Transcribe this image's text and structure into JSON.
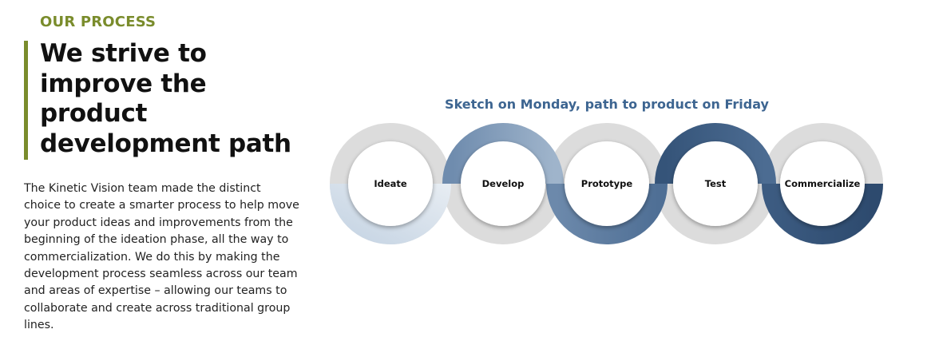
{
  "section": {
    "eyebrow": "OUR PROCESS",
    "headline": "We strive to improve the product development path",
    "body": "The Kinetic Vision team made the distinct choice to create a smarter process to help move your product ideas and improvements from the beginning of the ideation phase, all the way to commercialization. We do this by making the development process seamless across our team and areas of expertise – allowing our teams to collaborate and create across traditional group lines."
  },
  "diagram": {
    "title": "Sketch on Monday, path to product on Friday",
    "stages": [
      {
        "label": "Ideate"
      },
      {
        "label": "Develop"
      },
      {
        "label": "Prototype"
      },
      {
        "label": "Test"
      },
      {
        "label": "Commercialize"
      }
    ]
  },
  "colors": {
    "accent_green": "#7a8c2c",
    "title_blue": "#3d6591",
    "ring_grey": "#d9d9d9",
    "blue_light": "#c3d2e2",
    "blue_mid": "#7d98b7",
    "blue_dark": "#2f4c70",
    "text_dark": "#111111"
  }
}
